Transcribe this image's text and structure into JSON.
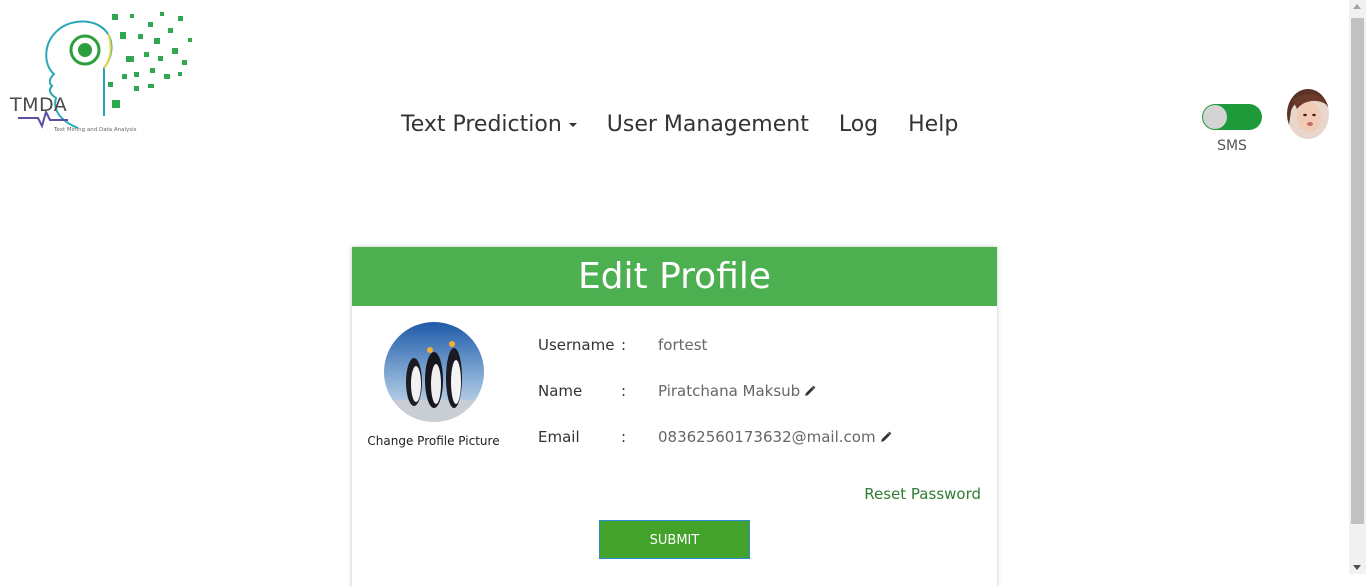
{
  "brand": {
    "logo_text": "TMDA",
    "logo_subtitle": "Text Mining and Data Analysis"
  },
  "nav": {
    "items": [
      {
        "label": "Text Prediction",
        "dropdown": true
      },
      {
        "label": "User Management"
      },
      {
        "label": "Log"
      },
      {
        "label": "Help"
      }
    ]
  },
  "toggle": {
    "label": "SMS",
    "on": true,
    "color": "#1e9a3a"
  },
  "card": {
    "title": "Edit Profile",
    "header_color": "#4caf50",
    "change_picture_label": "Change Profile Picture",
    "fields": {
      "username": {
        "label": "Username",
        "value": "fortest"
      },
      "name": {
        "label": "Name",
        "value": "Piratchana Maksub"
      },
      "email": {
        "label": "Email",
        "value": "08362560173632@mail.com"
      }
    },
    "colon": ":",
    "reset_password": "Reset Password",
    "submit": "SUBMIT"
  }
}
